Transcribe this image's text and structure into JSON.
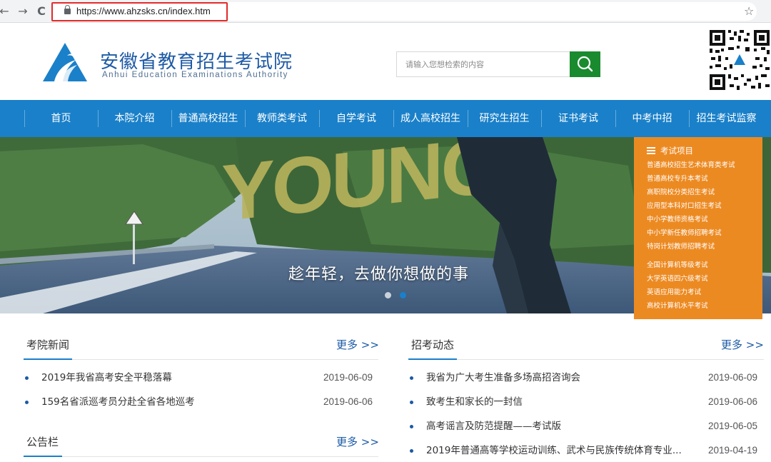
{
  "browser": {
    "url": "https://www.ahzsks.cn/index.htm",
    "back_glyph": "←",
    "forward_glyph": "→",
    "reload_glyph": "C",
    "star_glyph": "☆"
  },
  "header": {
    "title": "安徽省教育招生考试院",
    "subtitle": "Anhui Education Examinations Authority",
    "search_placeholder": "请输入您想检索的内容"
  },
  "nav": {
    "items": [
      "首页",
      "本院介绍",
      "普通高校招生",
      "教师类考试",
      "自学考试",
      "成人高校招生",
      "研究生招生",
      "证书考试",
      "中考中招",
      "招生考试监察"
    ]
  },
  "banner": {
    "slogan": "趁年轻，去做你想做的事",
    "watermark": "YOUNG"
  },
  "exam_panel": {
    "heading": "考试项目",
    "group1": [
      "普通高校招生艺术体育类考试",
      "普通高校专升本考试",
      "高职院校分类招生考试",
      "应用型本科对口招生考试",
      "中小学教师资格考试",
      "中小学新任教师招聘考试",
      "特岗计划教师招聘考试"
    ],
    "group2": [
      "全国计算机等级考试",
      "大学英语四六级考试",
      "英语应用能力考试",
      "高校计算机水平考试"
    ]
  },
  "news": {
    "title": "考院新闻",
    "more": "更多 >>",
    "items": [
      {
        "text": "2019年我省高考安全平稳落幕",
        "date": "2019-06-09"
      },
      {
        "text": "159名省派巡考员分赴全省各地巡考",
        "date": "2019-06-06"
      }
    ]
  },
  "notice": {
    "title": "公告栏",
    "more": "更多 >>"
  },
  "dynamics": {
    "title": "招考动态",
    "more": "更多 >>",
    "items": [
      {
        "text": "我省为广大考生准备多场高招咨询会",
        "date": "2019-06-09"
      },
      {
        "text": "致考生和家长的一封信",
        "date": "2019-06-06"
      },
      {
        "text": "高考谣言及防范提醒——考试版",
        "date": "2019-06-05"
      },
      {
        "text": "2019年普通高等学校运动训练、武术与民族传统体育专业...",
        "date": "2019-04-19"
      }
    ]
  },
  "colors": {
    "nav_blue": "#1a80c9",
    "panel_orange": "#ec8a22",
    "search_green": "#1a8a2e",
    "title_blue": "#1e5aa5"
  }
}
